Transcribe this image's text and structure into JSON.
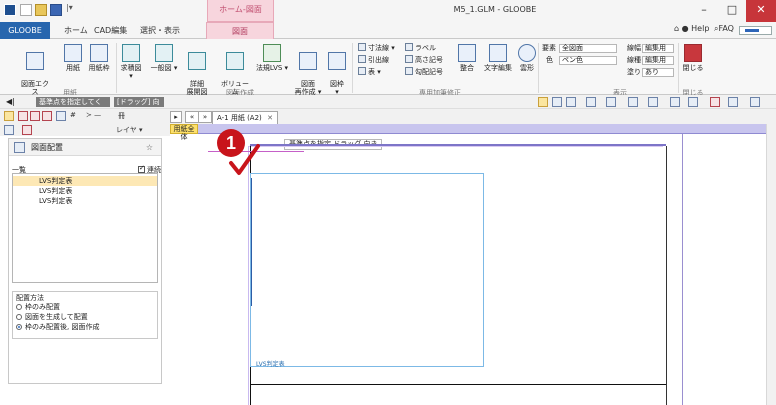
{
  "window": {
    "title": "M5_1.GLM - GLOOBE",
    "context_group": "ホーム-図面",
    "min": "–",
    "max": "□",
    "close": "✕"
  },
  "quick_access": {
    "more": "|▾"
  },
  "tabs": [
    "GLOOBE",
    "ホーム",
    "CAD編集",
    "選択・表示",
    "図面"
  ],
  "help": {
    "help_label": "Help",
    "faq_label": "FAQ"
  },
  "ribbon": {
    "export_label": "図面エクス\nプローラー",
    "paper_label": "用紙",
    "frame_label": "用紙枠",
    "groups": {
      "paper": "用紙",
      "create": "図面作成",
      "annotate": "専用加筆修正",
      "display": "表示",
      "close": "閉じる"
    },
    "buttons": [
      {
        "label": "求積図 ▾"
      },
      {
        "label": "一般図 ▾"
      },
      {
        "label": "詳細\n展開図 ▾"
      },
      {
        "label": "ボリューム\n解析 ▾"
      },
      {
        "label": "法規LVS ▾"
      },
      {
        "label": "図面\n再作成 ▾"
      },
      {
        "label": "図枠\n▾"
      }
    ],
    "small": [
      {
        "label": "寸法線 ▾"
      },
      {
        "label": "引出線"
      },
      {
        "label": "表 ▾"
      },
      {
        "label": "ラベル"
      },
      {
        "label": "高さ記号"
      },
      {
        "label": "勾配記号"
      }
    ],
    "shape_buttons": [
      {
        "label": "整合"
      },
      {
        "label": "文字編集"
      },
      {
        "label": "雲形"
      }
    ],
    "display": {
      "element_label": "要素",
      "element_value": "全図面",
      "color_label": "色",
      "color_value": "ペン色",
      "linewidth_label": "線幅",
      "linewidth_value": "編集用",
      "linetype_label": "線種",
      "linetype_value": "編集用",
      "fill_label": "塗り",
      "fill_value": "あり"
    },
    "close_label": "閉じる"
  },
  "toolbar": {
    "prompt_marker": "◀|",
    "prompt": "基準点を指定してください",
    "drag": "[ドラッグ] 向き",
    "layer": "レイヤ ▾",
    "symbol_hash": "#",
    "symbol_arrow": "≻ —",
    "symbol_fence": "冊"
  },
  "doc_tabs": {
    "prev": "▸",
    "back": "«",
    "fwd": "»",
    "active": "A-1 用紙 (A2)",
    "close": "✕"
  },
  "panel": {
    "title": "図面配置",
    "collapse": "☆",
    "list_label": "一覧",
    "continuous_label": "連続",
    "items": [
      "LVS判定表",
      "LVS判定表",
      "LVS判定表"
    ],
    "method_title": "配置方法",
    "methods": [
      {
        "label": "枠のみ配置",
        "checked": false
      },
      {
        "label": "図面を生成して配置",
        "checked": false
      },
      {
        "label": "枠のみ配置後, 図面作成",
        "checked": true
      }
    ]
  },
  "canvas": {
    "paper_tab": "用紙全体",
    "command_banner": "基準点を指定  ドラッグ  向き",
    "frame_label": "LVS判定表"
  },
  "callout": {
    "number": "1"
  }
}
